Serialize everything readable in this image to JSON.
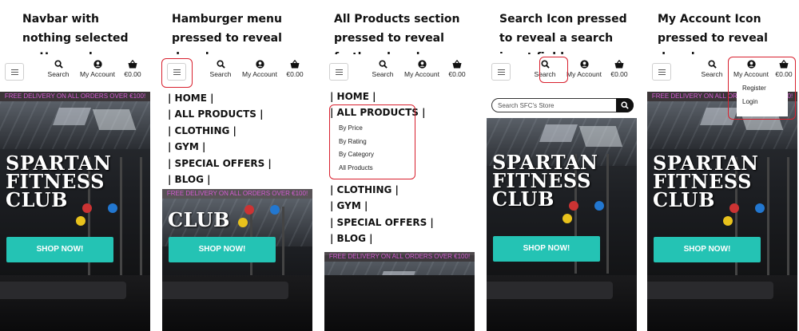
{
  "captions": [
    "Navbar with nothing selected or Hovered",
    "Hamburger menu pressed to reveal dropdown",
    "All Products section pressed to reveal further dropdown",
    "Search Icon pressed to reveal a search input field",
    "My Account Icon pressed to reveal dropdown"
  ],
  "navbar": {
    "search_label": "Search",
    "account_label": "My Account",
    "basket_total": "€0.00",
    "icons": [
      "menu-icon",
      "search-icon",
      "account-icon",
      "basket-icon"
    ]
  },
  "banner_text": "FREE DELIVERY ON ALL ORDERS OVER €100!",
  "hero": {
    "title_lines": [
      "SPARTAN",
      "FITNESS",
      "CLUB"
    ],
    "shop_button": "SHOP NOW!"
  },
  "menu_items": [
    "| HOME |",
    "| ALL PRODUCTS |",
    "| CLOTHING |",
    "| GYM |",
    "| SPECIAL OFFERS |",
    "| BLOG |"
  ],
  "products_submenu": [
    "By Price",
    "By Rating",
    "By Category",
    "All Products"
  ],
  "search": {
    "placeholder": "Search SFC's Store"
  },
  "account_dropdown": [
    "Register",
    "Login"
  ],
  "colors": {
    "teal": "#24c3b4",
    "banner_text": "#d35bd3",
    "highlight": "#d8202e",
    "banner_bg": "#3b3538"
  }
}
